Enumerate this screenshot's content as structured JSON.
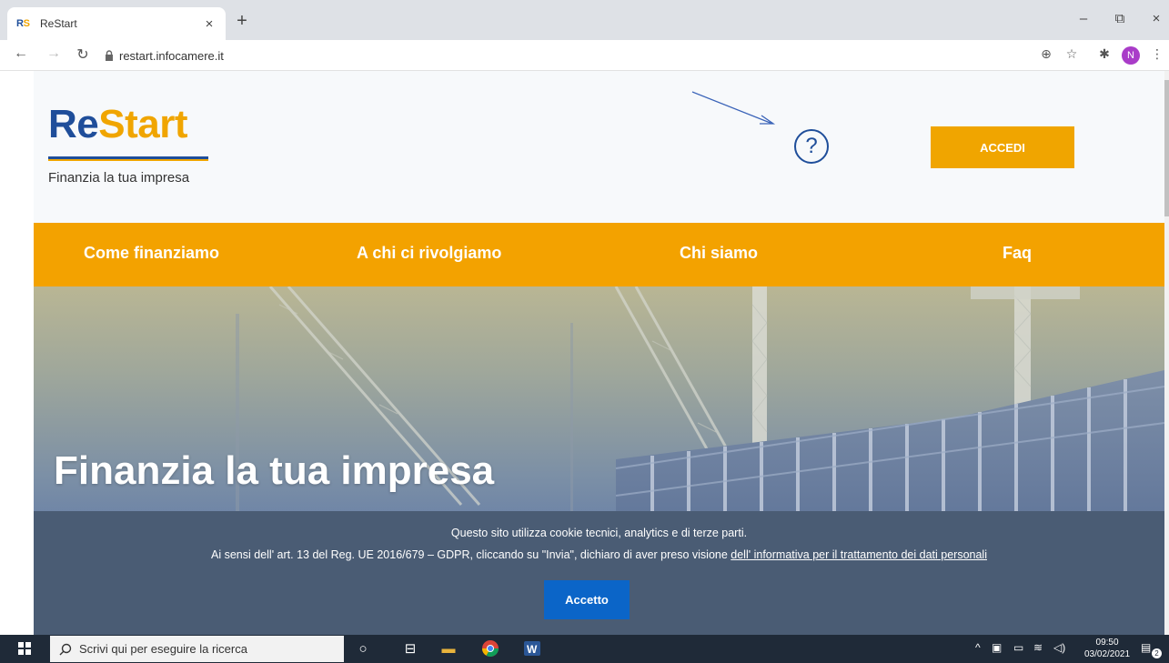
{
  "browser": {
    "tab_title": "ReStart",
    "favicon_re": "RS",
    "favicon_st": "",
    "tab_close": "×",
    "new_tab": "+",
    "url": "restart.infocamere.it",
    "avatar_letter": "N",
    "window_controls": {
      "minimize": "–",
      "maximize": "⧉",
      "close": "×"
    }
  },
  "header": {
    "logo_re": "Re",
    "logo_start": "Start",
    "tagline": "Finanzia la tua impresa",
    "help_symbol": "?",
    "login_button": "ACCEDI"
  },
  "nav": {
    "items": [
      {
        "label": "Come finanziamo"
      },
      {
        "label": "A chi ci rivolgiamo"
      },
      {
        "label": "Chi siamo"
      },
      {
        "label": "Faq"
      }
    ]
  },
  "hero": {
    "title": "Finanzia la tua impresa"
  },
  "cookie_banner": {
    "line1": "Questo sito utilizza cookie tecnici, analytics e di terze parti.",
    "line2_prefix": "Ai sensi dell' art. 13 del Reg. UE 2016/679 – GDPR, cliccando su \"Invia\", dichiaro di aver preso visione ",
    "line2_link": "dell' informativa per il trattamento dei dati personali",
    "accept_button": "Accetto"
  },
  "taskbar": {
    "search_placeholder": "Scrivi qui per eseguire la ricerca",
    "time": "09:50",
    "date": "03/02/2021",
    "notification_count": "2"
  },
  "colors": {
    "brand_blue": "#1f4e9a",
    "brand_orange": "#f3a200",
    "cookie_bg": "#4a5c74",
    "accept_blue": "#0b65c8"
  }
}
